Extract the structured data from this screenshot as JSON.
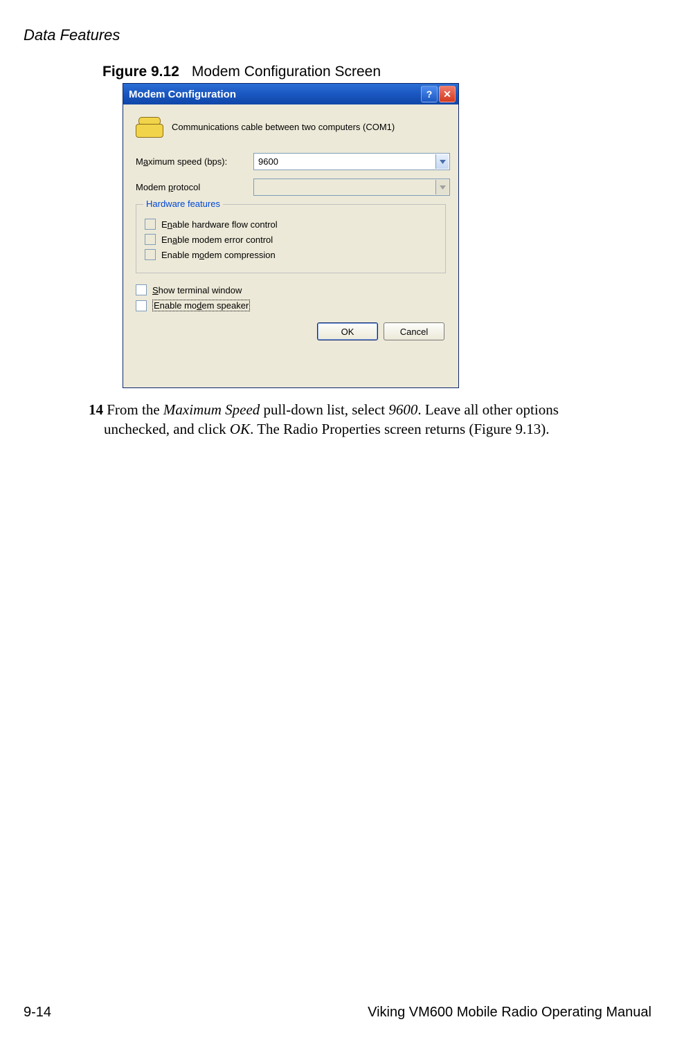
{
  "header": {
    "section_title": "Data Features"
  },
  "figure": {
    "number": "Figure 9.12",
    "title": "Modem Configuration Screen"
  },
  "dialog": {
    "title": "Modem Configuration",
    "device_text": "Communications cable between two computers (COM1)",
    "max_speed_label_pre": "M",
    "max_speed_label_u": "a",
    "max_speed_label_post": "ximum speed (bps):",
    "max_speed_value": "9600",
    "protocol_label_pre": "Modem ",
    "protocol_label_u": "p",
    "protocol_label_post": "rotocol",
    "protocol_value": "",
    "group_title": "Hardware features",
    "hw_flow_pre": "E",
    "hw_flow_u": "n",
    "hw_flow_post": "able hardware flow control",
    "err_pre": "En",
    "err_u": "a",
    "err_post": "ble modem error control",
    "comp_pre": "Enable m",
    "comp_u": "o",
    "comp_post": "dem compression",
    "term_pre": "",
    "term_u": "S",
    "term_post": "how terminal window",
    "spk_pre": "Enable mo",
    "spk_u": "d",
    "spk_post": "em speaker",
    "ok_label": "OK",
    "cancel_label": "Cancel"
  },
  "instruction": {
    "number": "14",
    "part1": " From the ",
    "italic1": "Maximum Speed",
    "part2": " pull-down list, select ",
    "italic2": "9600",
    "part3": ". Leave all other options",
    "line2a": "unchecked, and click ",
    "italic3": "OK",
    "line2b": ". The Radio Properties screen returns (Figure 9.13)."
  },
  "footer": {
    "page": "9-14",
    "manual": "Viking VM600 Mobile Radio Operating Manual"
  }
}
